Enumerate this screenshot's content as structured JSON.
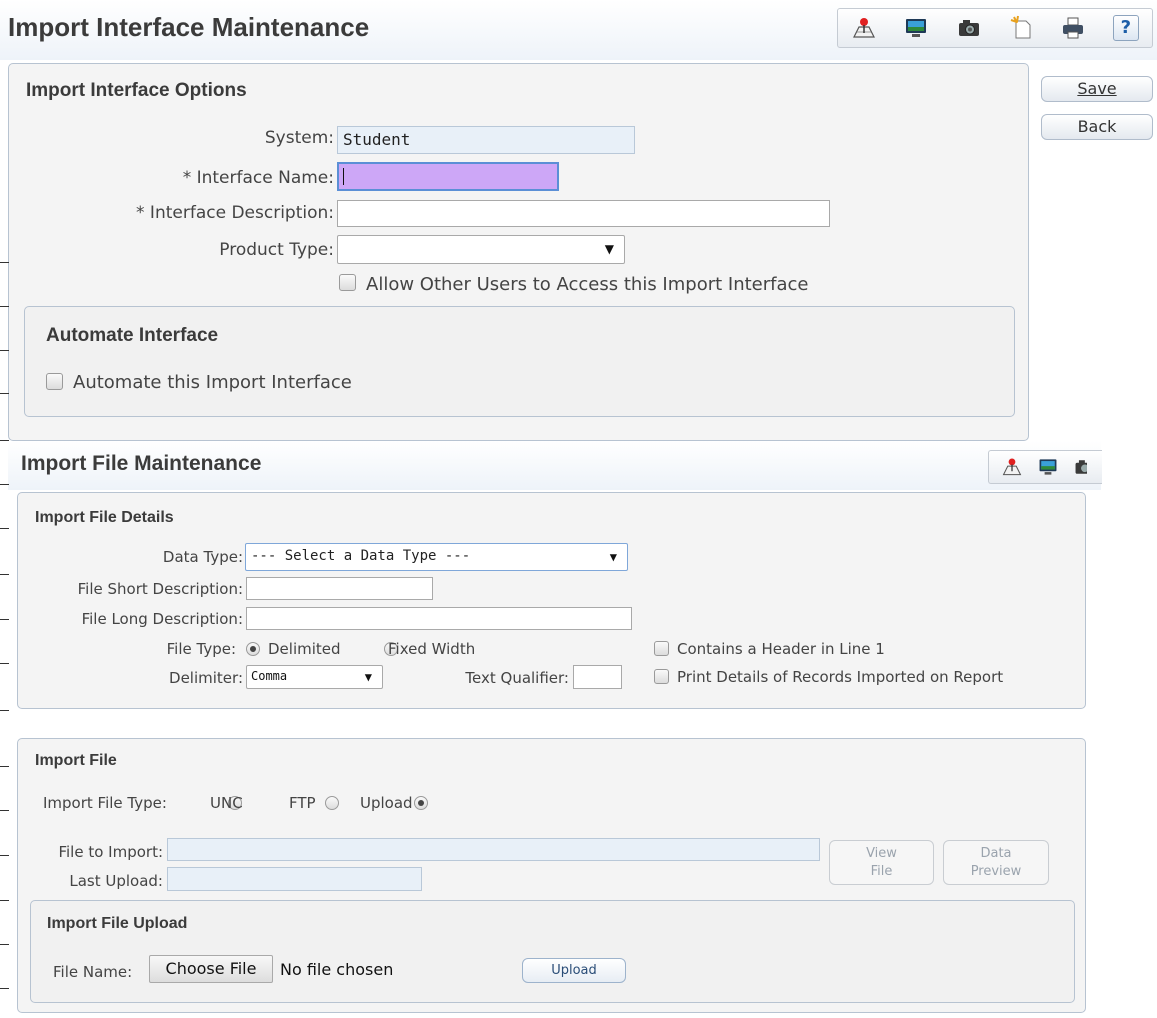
{
  "header1": {
    "title": "Import Interface Maintenance",
    "icons": [
      "map-pin-icon",
      "monitor-icon",
      "camera-icon",
      "new-document-icon",
      "print-icon",
      "help-icon"
    ],
    "help_label": "?"
  },
  "side_buttons": {
    "save": "Save",
    "back": "Back"
  },
  "options": {
    "title": "Import Interface Options",
    "system_label": "System:",
    "system_value": "Student",
    "interface_name_label": "* Interface Name:",
    "interface_name_value": "",
    "interface_desc_label": "* Interface Description:",
    "interface_desc_value": "",
    "product_type_label": "Product Type:",
    "product_type_value": "",
    "allow_access_label": "Allow Other Users to Access this Import Interface",
    "allow_access_checked": false
  },
  "automate": {
    "title": "Automate Interface",
    "checkbox_label": "Automate this Import Interface",
    "checked": false
  },
  "header2": {
    "title": "Import File Maintenance",
    "icons": [
      "map-pin-icon",
      "monitor-icon",
      "camera-icon"
    ]
  },
  "file_details": {
    "title": "Import File Details",
    "data_type_label": "Data Type:",
    "data_type_value": "--- Select a Data Type ---",
    "short_desc_label": "File Short Description:",
    "short_desc_value": "",
    "long_desc_label": "File Long Description:",
    "long_desc_value": "",
    "file_type_label": "File Type:",
    "file_type_options": [
      "Delimited",
      "Fixed Width"
    ],
    "file_type_selected": "Delimited",
    "delimiter_label": "Delimiter:",
    "delimiter_value": "Comma",
    "text_qualifier_label": "Text Qualifier:",
    "text_qualifier_value": "",
    "header_line_label": "Contains a Header in Line 1",
    "print_details_label": "Print Details of Records Imported on Report"
  },
  "import_file": {
    "title": "Import File",
    "file_type_label": "Import File Type:",
    "file_type_options": [
      "UNC",
      "FTP",
      "Upload"
    ],
    "file_type_selected": "Upload",
    "file_to_import_label": "File to Import:",
    "file_to_import_value": "",
    "last_upload_label": "Last Upload:",
    "last_upload_value": "",
    "view_file_line1": "View",
    "view_file_line2": "File",
    "data_preview_line1": "Data",
    "data_preview_line2": "Preview"
  },
  "upload": {
    "title": "Import File Upload",
    "file_name_label": "File Name:",
    "choose_file_label": "Choose File",
    "no_file_text": "No file chosen",
    "upload_button": "Upload"
  },
  "colors": {
    "interface_name_bg": "#cda7f7",
    "panel_border": "#b7c3d1",
    "readonly_bg": "#e8f0f8"
  }
}
